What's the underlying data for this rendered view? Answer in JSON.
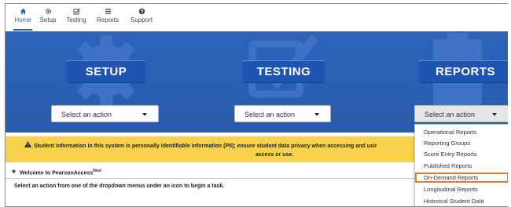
{
  "nav": {
    "items": [
      {
        "label": "Home",
        "icon": "home-icon"
      },
      {
        "label": "Setup",
        "icon": "gear-icon"
      },
      {
        "label": "Testing",
        "icon": "checkbox-icon"
      },
      {
        "label": "Reports",
        "icon": "reports-icon"
      },
      {
        "label": "Support",
        "icon": "help-icon"
      }
    ],
    "active": "Home"
  },
  "tiles": [
    {
      "title": "SETUP",
      "select_label": "Select an action"
    },
    {
      "title": "TESTING",
      "select_label": "Select an action"
    },
    {
      "title": "REPORTS",
      "select_label": "Select an action"
    }
  ],
  "reports_menu": {
    "items": [
      "Operational Reports",
      "Reporting Groups",
      "Score Entry Reports",
      "Published Reports",
      "On-Demand Reports",
      "Longitudinal Reports",
      "Historical Student Data"
    ],
    "highlighted": "On-Demand Reports"
  },
  "warning": {
    "line1": "Student information in this system is personally identifiable information (PII); ensure student data privacy when accessing and usir",
    "line2": "access or use."
  },
  "welcome": {
    "title": "Welcome to PearsonAccess",
    "superscript": "Next",
    "instruction": "Select an action from one of the dropdown menus under an icon to begin a task."
  },
  "colors": {
    "accent": "#2563c7",
    "banner": "#2d63b8",
    "warning": "#f7d24a",
    "highlight_border": "#e07a2e"
  }
}
